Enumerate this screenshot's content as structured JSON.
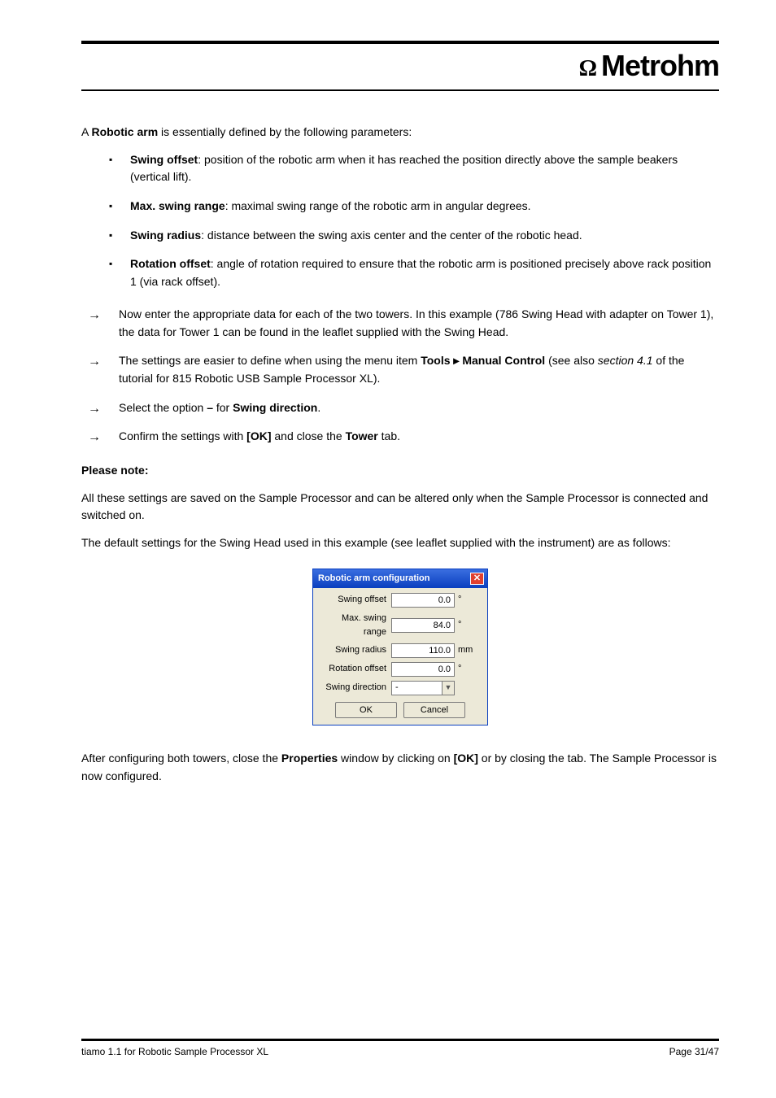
{
  "logo": {
    "symbol": "Ω",
    "text": "Metrohm"
  },
  "intro": "A <b>Robotic arm</b> is essentially defined by the following parameters:",
  "bullets": [
    "<b>Swing offset</b>: position of the robotic arm when it has reached the position directly above the sample beakers (vertical lift).",
    "<b>Max. swing range</b>: maximal swing range of the robotic arm in angular degrees.",
    "<b>Swing radius</b>: distance between the swing axis center and the center of the robotic head.",
    "<b>Rotation offset</b>: angle of rotation required to ensure that the robotic arm is positioned precisely above rack position 1 (via rack offset)."
  ],
  "arrows": [
    "Now enter the appropriate data for each of the two towers. In this example (786 Swing Head with adapter on Tower 1), the data for Tower 1 can be found in the leaflet supplied with the Swing Head.",
    "The settings are easier to define when using the menu item <b>Tools ▸ Manual Control</b> (see also <i>section 4.1</i> of the tutorial for 815 Robotic USB Sample Processor XL).",
    "Select the option <b>–</b> for <b>Swing direction</b>.",
    "Confirm the settings with <b>[OK]</b> and close the <b>Tower</b> tab."
  ],
  "note": {
    "lead": "Please note:",
    "para1": "All these settings are saved on the Sample Processor and can be altered only when the Sample Processor is connected and switched on.",
    "para2": "The default settings for the Swing Head used in this example (see leaflet supplied with the instrument) are as follows:"
  },
  "dialog": {
    "title": "Robotic arm configuration",
    "rows": [
      {
        "label": "Swing offset",
        "value": "0.0",
        "unit": "°"
      },
      {
        "label": "Max. swing range",
        "value": "84.0",
        "unit": "°"
      },
      {
        "label": "Swing radius",
        "value": "110.0",
        "unit": "mm"
      },
      {
        "label": "Rotation offset",
        "value": "0.0",
        "unit": "°"
      }
    ],
    "selectRow": {
      "label": "Swing direction",
      "value": "-"
    },
    "ok": "OK",
    "cancel": "Cancel"
  },
  "closing": "After configuring both towers, close the <b>Properties</b> window by clicking on <b>[OK]</b> or by closing the tab. The Sample Processor is now configured.",
  "footer": {
    "left": "tiamo 1.1 for Robotic Sample Processor XL",
    "right": "Page 31/47"
  }
}
